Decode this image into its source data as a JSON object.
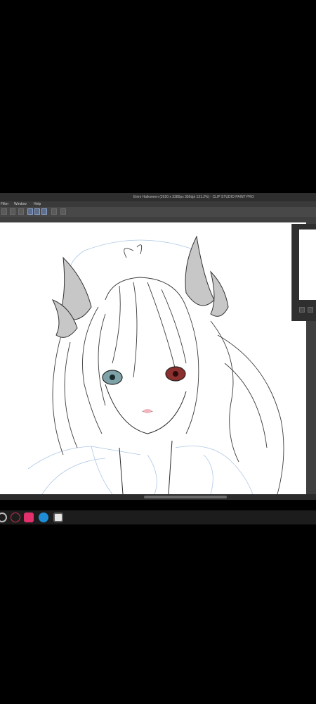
{
  "window": {
    "title": "Eirini Halloween (2620 x 3380px 350dpi 131.2%) - CLIP STUDIO PAINT PRO"
  },
  "menu": {
    "items": [
      "Filter",
      "Window",
      "Help"
    ]
  },
  "toolbar": {
    "icons": [
      "undo-icon",
      "redo-icon",
      "clear-icon",
      "pen-tool-icon",
      "pencil-tool-icon",
      "brush-tool-icon",
      "stamp-icon"
    ]
  },
  "canvas": {
    "content": "line-art illustration"
  },
  "taskbar": {
    "apps": [
      "search",
      "itch",
      "instagram",
      "edge",
      "clip-studio-paint"
    ]
  },
  "colors": {
    "accent": "#8aa0c8",
    "instagram": "#e1306c",
    "edge": "#1f8dd6"
  }
}
